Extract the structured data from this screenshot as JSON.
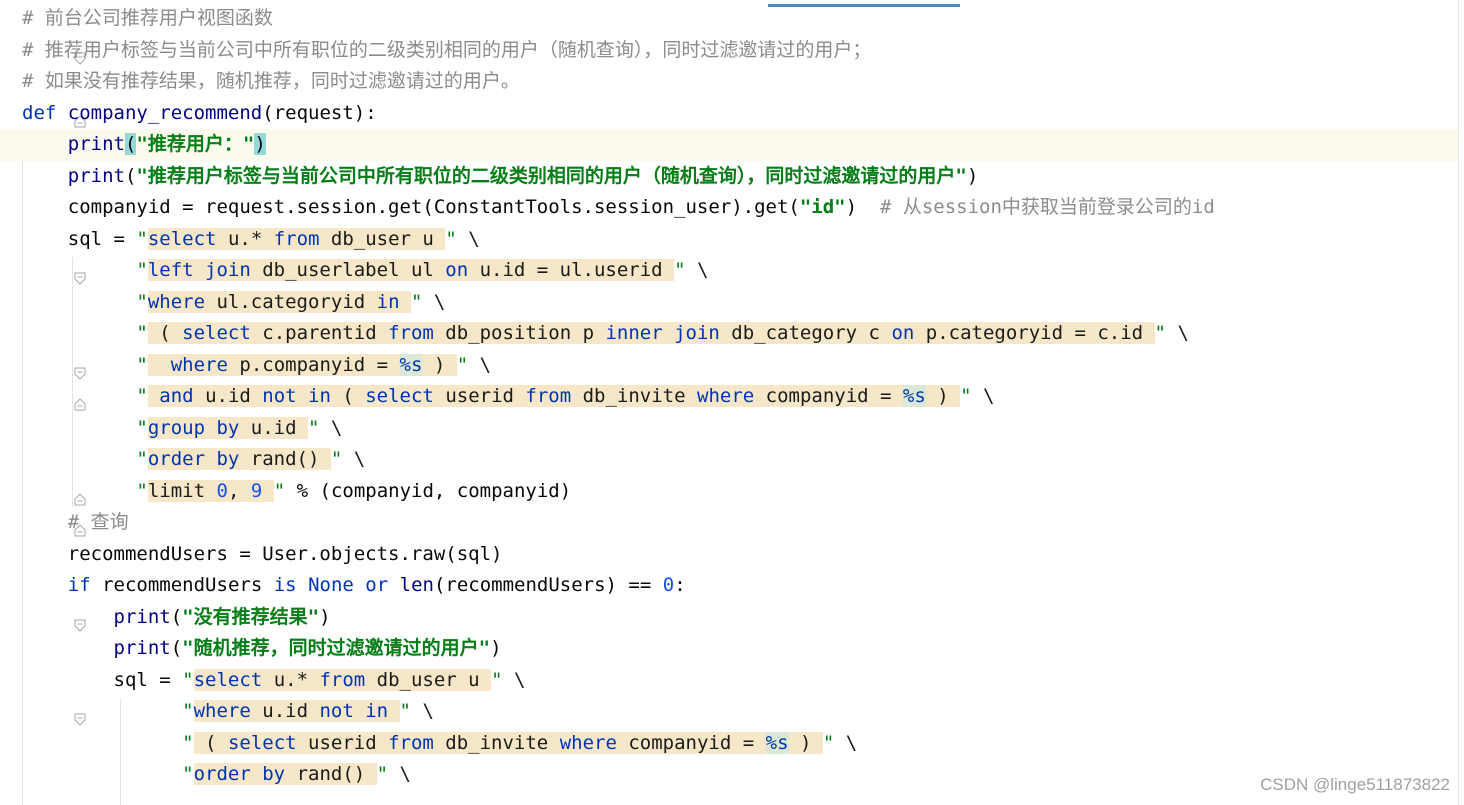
{
  "editor": {
    "language": "Python",
    "current_line": 5,
    "colors": {
      "keyword": "#0033b3",
      "string": "#067d17",
      "comment": "#8c8c8c",
      "number": "#1750eb",
      "injection_bg": "#f5e7c7",
      "current_line_bg": "#fcfaed",
      "brace_match_bg": "#93d9d9"
    }
  },
  "lines": {
    "l1": "# 前台公司推荐用户视图函数",
    "l2": "# 推荐用户标签与当前公司中所有职位的二级类别相同的用户（随机查询），同时过滤邀请过的用户；",
    "l3": "# 如果没有推荐结果，随机推荐，同时过滤邀请过的用户。",
    "l4_kw": "def",
    "l4_name": "company_recommend",
    "l4_rest": "(request):",
    "l5_fn": "print",
    "l5_open": "(",
    "l5_str": "\"推荐用户：\"",
    "l5_close": ")",
    "l6_fn": "print",
    "l6_str": "\"推荐用户标签与当前公司中所有职位的二级类别相同的用户（随机查询），同时过滤邀请过的用户\"",
    "l7_code": "companyid = request.session.get(ConstantTools.session_user).get(",
    "l7_str": "\"id\"",
    "l7_close": ")",
    "l7_comment": "# 从session中获取当前登录公司的id",
    "l8_pre": "sql = ",
    "l9": "\"left join db_userlabel ul on u.id = ul.userid \"",
    "l10": "\"where ul.categoryid in \"",
    "l11": "\" ( select c.parentid from db_position p inner join db_category c on p.categoryid = c.id \"",
    "l12": "\"  where p.companyid = %s ) \"",
    "l13": "\" and u.id not in ( select userid from db_invite where companyid = %s ) \"",
    "l14": "\"group by u.id \"",
    "l15": "\"order by rand() \"",
    "l16_tail": "% (companyid, companyid)",
    "l17": "# 查询",
    "l18": "recommendUsers = User.objects.raw(sql)",
    "l19_kw1": "if",
    "l19_a": "recommendUsers",
    "l19_kw2": "is",
    "l19_kw3": "None",
    "l19_kw4": "or",
    "l19_fn": "len",
    "l19_b": "(recommendUsers) ==",
    "l19_num": "0",
    "l19_c": ":",
    "l20_fn": "print",
    "l20_str": "\"没有推荐结果\"",
    "l21_fn": "print",
    "l21_str": "\"随机推荐，同时过滤邀请过的用户\"",
    "l22_pre": "sql = ",
    "l23": "\"where u.id not in \"",
    "l24": "\" ( select userid from db_invite where companyid = %s ) \"",
    "l25": "\"order by rand() \""
  },
  "watermark": "CSDN @linge511873822"
}
